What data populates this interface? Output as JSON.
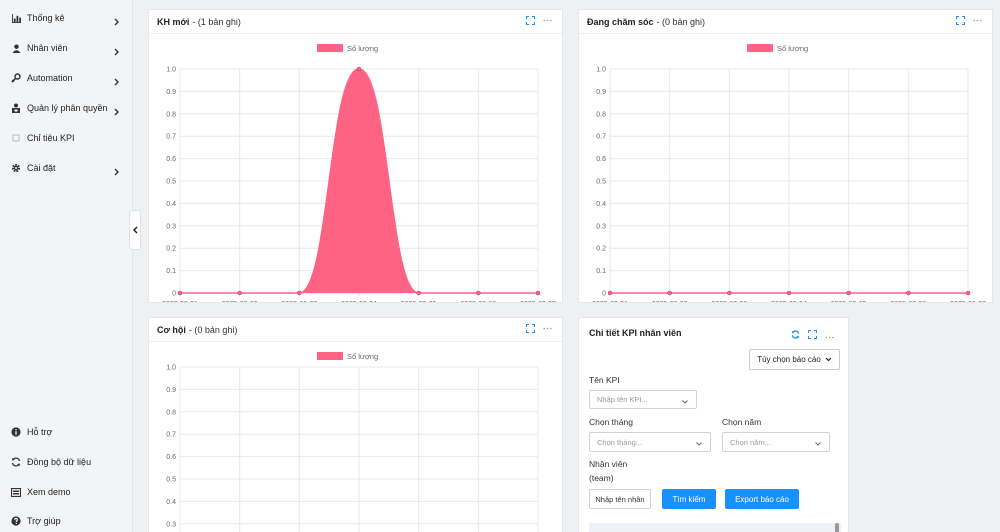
{
  "sidebar": {
    "items": [
      {
        "label": "Thống kê",
        "icon": "bar-chart-icon",
        "has_arrow": true
      },
      {
        "label": "Nhân viên",
        "icon": "user-icon",
        "has_arrow": true
      },
      {
        "label": "Automation",
        "icon": "key-icon",
        "has_arrow": true
      },
      {
        "label": "Quản lý phân quyền",
        "icon": "users-lock-icon",
        "has_arrow": true
      },
      {
        "label": "Chỉ tiêu KPI",
        "icon": "square-icon",
        "has_arrow": false
      },
      {
        "label": "Cài đặt",
        "icon": "gear-icon",
        "has_arrow": true
      }
    ],
    "bottom_items": [
      {
        "label": "Hỗ trợ",
        "icon": "info-icon"
      },
      {
        "label": "Đồng bộ dữ liệu",
        "icon": "sync-icon"
      },
      {
        "label": "Xem demo",
        "icon": "monitor-icon"
      },
      {
        "label": "Trợ giúp",
        "icon": "question-icon"
      }
    ]
  },
  "panels": {
    "kh_moi": {
      "title": "KH mới",
      "count": "- (1 bản ghi)"
    },
    "dang_cham_soc": {
      "title": "Đang chăm sóc",
      "count": "- (0 bản ghi)"
    },
    "co_hoi": {
      "title": "Cơ hội",
      "count": "- (0 bản ghi)"
    }
  },
  "kpi": {
    "title": "Chi tiết KPI nhân viên",
    "report_button": "Tùy chọn báo cáo",
    "kpi_name_label": "Tên KPI",
    "kpi_name_placeholder": "Nhập tên KPI...",
    "month_label": "Chọn tháng",
    "month_placeholder": "Chọn tháng...",
    "year_label": "Chọn năm",
    "year_placeholder": "Chọn năm...",
    "staff_label_line1": "Nhân viên",
    "staff_label_line2": "(team)",
    "staff_placeholder": "Nhập tên nhân",
    "search_button": "Tìm kiếm",
    "export_button": "Export báo cáo"
  },
  "colors": {
    "series": "#ff6384",
    "primary": "#1890ff"
  },
  "chart_data": [
    {
      "type": "area",
      "legend": [
        "Số lượng"
      ],
      "x": [
        "2025-09-01",
        "2025-09-02",
        "2025-09-03",
        "2025-09-04",
        "2025-09-05",
        "2025-09-06",
        "2025-09-07"
      ],
      "series": [
        {
          "name": "Số lượng",
          "values": [
            0,
            0,
            0,
            1,
            0,
            0,
            0
          ]
        }
      ],
      "ylim": [
        0,
        1
      ],
      "yticks": [
        "1.0",
        "0.9",
        "0.8",
        "0.7",
        "0.6",
        "0.5",
        "0.4",
        "0.3",
        "0.2",
        "0.1",
        "0"
      ],
      "legend_position": "top-center",
      "grid": true
    },
    {
      "type": "area",
      "legend": [
        "Số lượng"
      ],
      "x": [
        "2025-09-01",
        "2025-09-02",
        "2025-09-03",
        "2025-09-04",
        "2025-09-05",
        "2025-09-06",
        "2025-09-07"
      ],
      "series": [
        {
          "name": "Số lượng",
          "values": [
            0,
            0,
            0,
            0,
            0,
            0,
            0
          ]
        }
      ],
      "ylim": [
        0,
        1
      ],
      "yticks": [
        "1.0",
        "0.9",
        "0.8",
        "0.7",
        "0.6",
        "0.5",
        "0.4",
        "0.3",
        "0.2",
        "0.1",
        "0"
      ],
      "legend_position": "top-center",
      "grid": true
    },
    {
      "type": "area",
      "legend": [
        "Số lượng"
      ],
      "x": [],
      "series": [
        {
          "name": "Số lượng",
          "values": []
        }
      ],
      "ylim": [
        0,
        1
      ],
      "yticks": [
        "1.0",
        "0.9",
        "0.8",
        "0.7",
        "0.6",
        "0.5",
        "0.4",
        "0.3"
      ],
      "legend_position": "top-center",
      "grid": true
    }
  ]
}
